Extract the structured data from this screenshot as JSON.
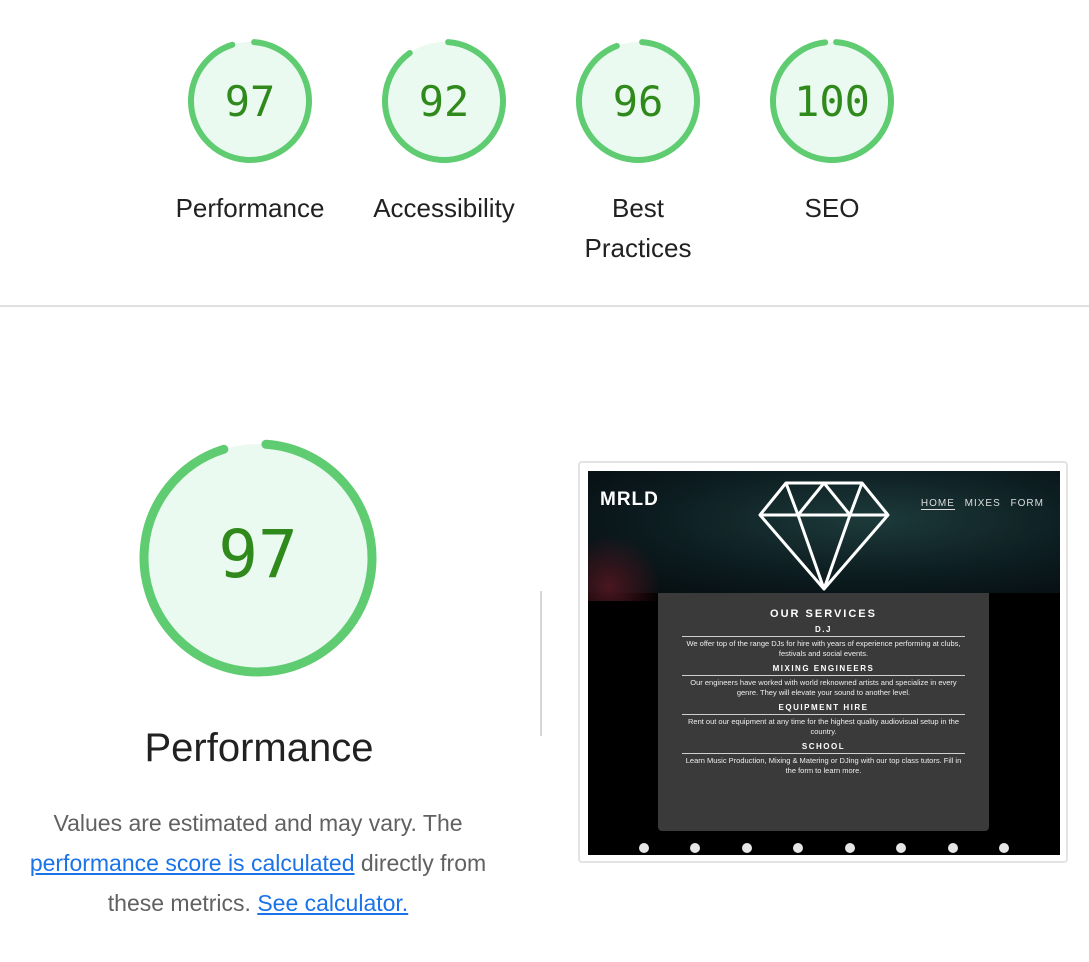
{
  "categories": [
    {
      "label_lines": [
        "Performance"
      ],
      "score": 97,
      "color": "#0cce6b"
    },
    {
      "label_lines": [
        "Accessibility"
      ],
      "score": 92,
      "color": "#0cce6b"
    },
    {
      "label_lines": [
        "Best",
        "Practices"
      ],
      "score": 96,
      "color": "#0cce6b"
    },
    {
      "label_lines": [
        "SEO"
      ],
      "score": 100,
      "color": "#0cce6b"
    }
  ],
  "performance": {
    "score": 97,
    "title": "Performance",
    "desc_part1": "Values are estimated and may vary. The",
    "desc_link1": "performance score is calculated",
    "desc_part2": "directly from these metrics.",
    "desc_link2": "See calculator."
  },
  "screenshot": {
    "logo": "MRLD",
    "nav": [
      "HOME",
      "MIXES",
      "FORM"
    ],
    "panel_title": "OUR SERVICES",
    "services": [
      {
        "name": "D.J",
        "desc": "We offer top of the range DJs for hire with years of experience performing at clubs, festivals and social events."
      },
      {
        "name": "MIXING ENGINEERS",
        "desc": "Our engineers have worked with world reknowned artists and specialize in every genre. They will elevate your sound to another level."
      },
      {
        "name": "EQUIPMENT HIRE",
        "desc": "Rent out our equipment at any time for the highest quality audiovisual setup in the country."
      },
      {
        "name": "SCHOOL",
        "desc": "Learn Music Production, Mixing & Matering or DJing with our top class tutors. Fill in the form to learn more."
      }
    ],
    "footer_icons": [
      "phone-icon",
      "location-icon",
      "mail-icon",
      "soundcloud-icon",
      "spotify-icon",
      "facebook-icon",
      "youtube-icon",
      "instagram-icon"
    ]
  },
  "colors": {
    "pass": "#0cce6b",
    "pass_text": "#008800",
    "pass_fill": "#e6f8ee",
    "link": "#1a73e8"
  }
}
